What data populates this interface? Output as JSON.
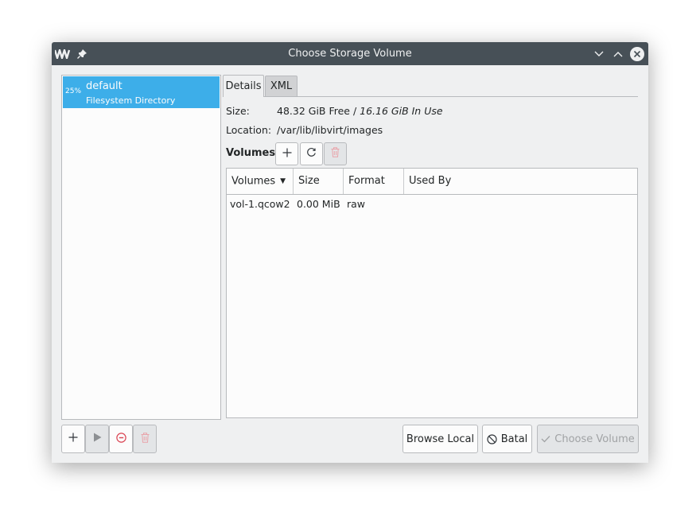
{
  "window": {
    "title": "Choose Storage Volume",
    "app_icon": "virt-manager-logo",
    "controls": [
      "pin-icon",
      "minimize-icon",
      "maximize-icon",
      "close-icon"
    ]
  },
  "pools": [
    {
      "usage": "25%",
      "name": "default",
      "type": "Filesystem Directory",
      "selected": true
    }
  ],
  "tabs": [
    {
      "label": "Details",
      "active": true
    },
    {
      "label": "XML",
      "active": false
    }
  ],
  "details": {
    "size_label": "Size:",
    "size_free": "48.32 GiB Free / ",
    "size_in_use": "16.16 GiB In Use",
    "location_label": "Location:",
    "location_value": "/var/lib/libvirt/images"
  },
  "volumes": {
    "heading": "Volumes",
    "columns": [
      "Volumes",
      "Size",
      "Format",
      "Used By"
    ],
    "rows": [
      {
        "name": "vol-1.qcow2",
        "size": "0.00 MiB",
        "format": "raw",
        "used_by": ""
      }
    ]
  },
  "buttons": {
    "browse_local": "Browse Local",
    "cancel": "Batal",
    "choose_volume": "Choose Volume"
  },
  "colors": {
    "titlebar": "#475057",
    "selection": "#3daee9",
    "window_bg": "#eff0f1",
    "danger": "#da4453"
  }
}
